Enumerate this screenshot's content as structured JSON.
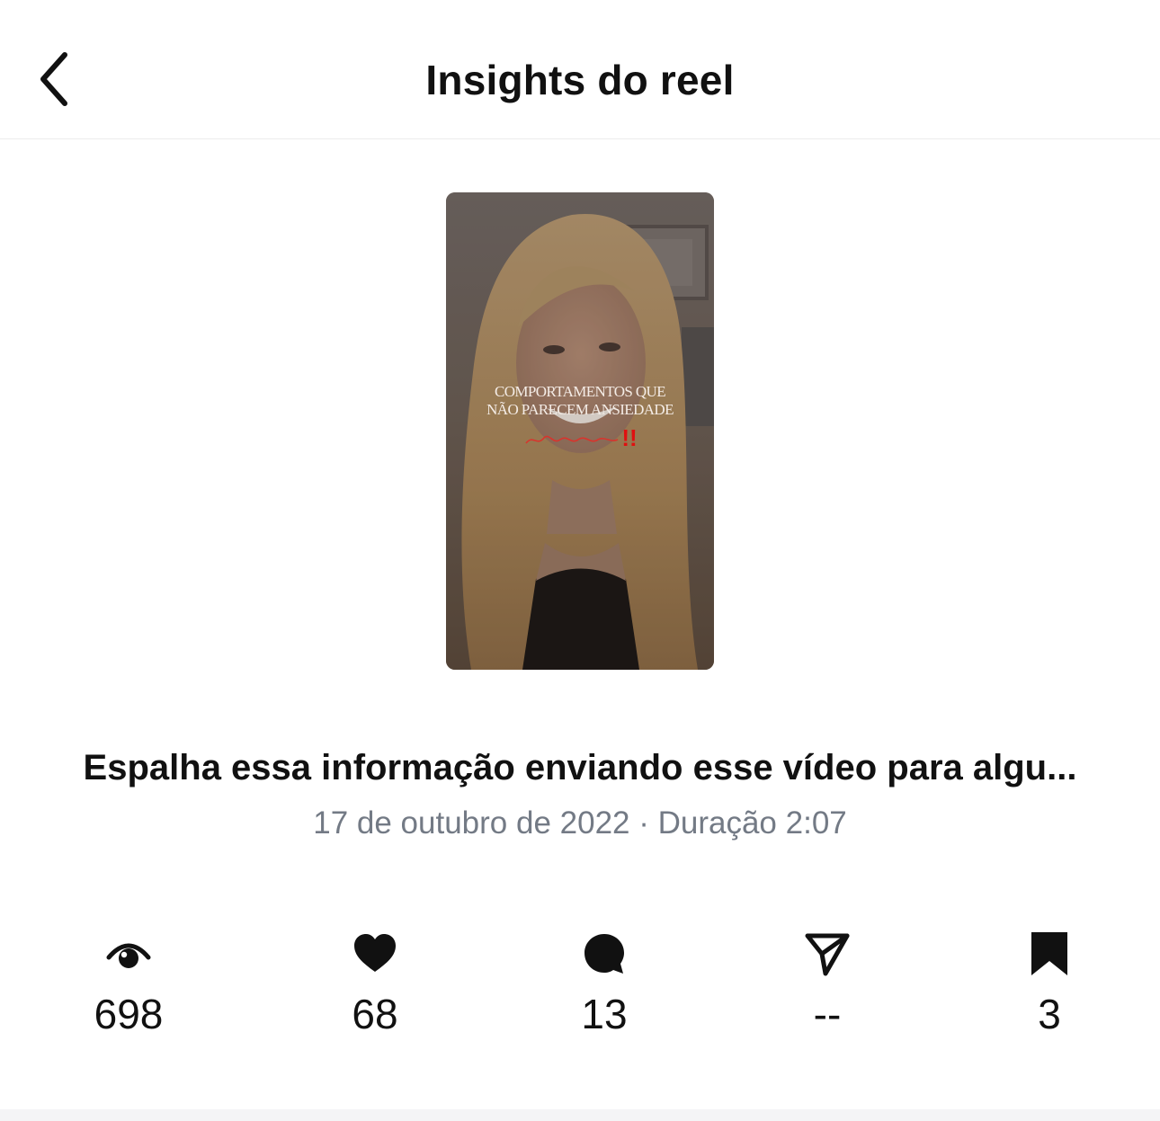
{
  "header": {
    "title": "Insights do reel",
    "back_icon": "chevron-left-icon"
  },
  "reel": {
    "thumbnail_text_line1": "COMPORTAMENTOS QUE",
    "thumbnail_text_line2": "NÃO PARECEM ANSIEDADE",
    "thumbnail_emphasis": "!!",
    "caption": "Espalha essa informação enviando esse vídeo para algu...",
    "meta": "17 de outubro de 2022 · Duração 2:07"
  },
  "stats": [
    {
      "icon": "eye-icon",
      "value": "698"
    },
    {
      "icon": "heart-icon",
      "value": "68"
    },
    {
      "icon": "comment-icon",
      "value": "13"
    },
    {
      "icon": "share-icon",
      "value": "--"
    },
    {
      "icon": "bookmark-icon",
      "value": "3"
    }
  ]
}
